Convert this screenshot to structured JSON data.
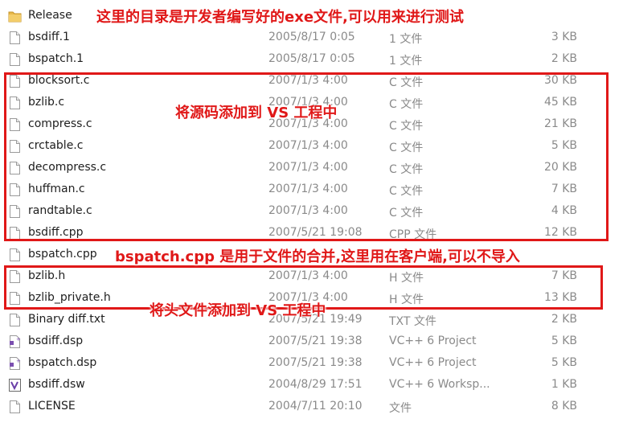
{
  "files": [
    {
      "name": "Release",
      "date": "",
      "type": "",
      "size": "",
      "icon": "folder-icon"
    },
    {
      "name": "bsdiff.1",
      "date": "2005/8/17 0:05",
      "type": "1 文件",
      "size": "3 KB",
      "icon": "file-icon"
    },
    {
      "name": "bspatch.1",
      "date": "2005/8/17 0:05",
      "type": "1 文件",
      "size": "2 KB",
      "icon": "file-icon"
    },
    {
      "name": "blocksort.c",
      "date": "2007/1/3 4:00",
      "type": "C 文件",
      "size": "30 KB",
      "icon": "file-icon"
    },
    {
      "name": "bzlib.c",
      "date": "2007/1/3 4:00",
      "type": "C 文件",
      "size": "45 KB",
      "icon": "file-icon"
    },
    {
      "name": "compress.c",
      "date": "2007/1/3 4:00",
      "type": "C 文件",
      "size": "21 KB",
      "icon": "file-icon"
    },
    {
      "name": "crctable.c",
      "date": "2007/1/3 4:00",
      "type": "C 文件",
      "size": "5 KB",
      "icon": "file-icon"
    },
    {
      "name": "decompress.c",
      "date": "2007/1/3 4:00",
      "type": "C 文件",
      "size": "20 KB",
      "icon": "file-icon"
    },
    {
      "name": "huffman.c",
      "date": "2007/1/3 4:00",
      "type": "C 文件",
      "size": "7 KB",
      "icon": "file-icon"
    },
    {
      "name": "randtable.c",
      "date": "2007/1/3 4:00",
      "type": "C 文件",
      "size": "4 KB",
      "icon": "file-icon"
    },
    {
      "name": "bsdiff.cpp",
      "date": "2007/5/21 19:08",
      "type": "CPP 文件",
      "size": "12 KB",
      "icon": "file-icon"
    },
    {
      "name": "bspatch.cpp",
      "date": "",
      "type": "",
      "size": "",
      "icon": "file-icon"
    },
    {
      "name": "bzlib.h",
      "date": "2007/1/3 4:00",
      "type": "H 文件",
      "size": "7 KB",
      "icon": "file-icon"
    },
    {
      "name": "bzlib_private.h",
      "date": "2007/1/3 4:00",
      "type": "H 文件",
      "size": "13 KB",
      "icon": "file-icon"
    },
    {
      "name": "Binary diff.txt",
      "date": "2007/5/21 19:49",
      "type": "TXT 文件",
      "size": "2 KB",
      "icon": "file-icon"
    },
    {
      "name": "bsdiff.dsp",
      "date": "2007/5/21 19:38",
      "type": "VC++ 6 Project",
      "size": "5 KB",
      "icon": "project-icon"
    },
    {
      "name": "bspatch.dsp",
      "date": "2007/5/21 19:38",
      "type": "VC++ 6 Project",
      "size": "5 KB",
      "icon": "project-icon"
    },
    {
      "name": "bsdiff.dsw",
      "date": "2004/8/29 17:51",
      "type": "VC++ 6 Worksp...",
      "size": "1 KB",
      "icon": "workspace-icon"
    },
    {
      "name": "LICENSE",
      "date": "2004/7/11 20:10",
      "type": "文件",
      "size": "8 KB",
      "icon": "file-icon"
    }
  ],
  "annotations": {
    "release_note": "这里的目录是开发者编写好的exe文件,可以用来进行测试",
    "source_note": "将源码添加到 VS 工程中",
    "bspatch_note": "bspatch.cpp 是用于文件的合并,这里用在客户端,可以不导入",
    "header_note": "将头文件添加到 VS 工程中"
  },
  "colors": {
    "annotation": "#e01818",
    "meta_text": "#8a8a8a",
    "folder": "#e8b84a"
  }
}
